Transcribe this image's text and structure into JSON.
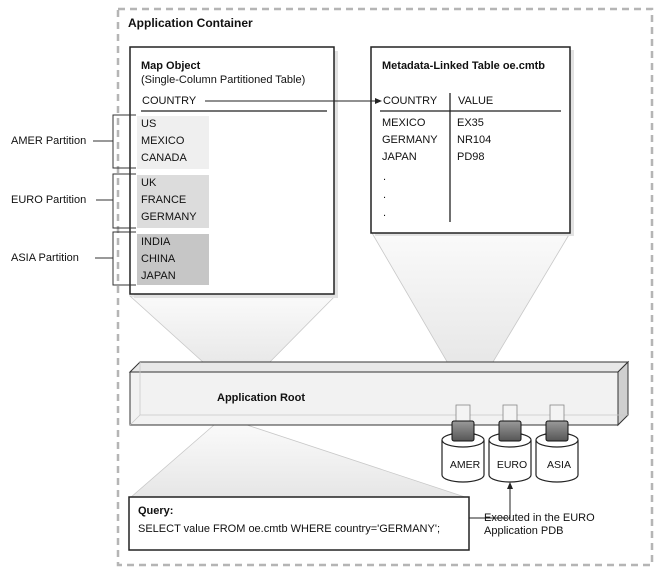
{
  "container": {
    "title": "Application Container"
  },
  "map_object": {
    "title": "Map Object",
    "subtitle": "(Single-Column Partitioned Table)",
    "column": "COUNTRY",
    "partitions": [
      {
        "label": "AMER Partition",
        "rows": [
          "US",
          "MEXICO",
          "CANADA"
        ],
        "color": "#eeeeee"
      },
      {
        "label": "EURO Partition",
        "rows": [
          "UK",
          "FRANCE",
          "GERMANY"
        ],
        "color": "#dcdcdc"
      },
      {
        "label": "ASIA Partition",
        "rows": [
          "INDIA",
          "CHINA",
          "JAPAN"
        ],
        "color": "#c4c4c4"
      }
    ]
  },
  "linked_table": {
    "title": "Metadata-Linked Table oe.cmtb",
    "columns": [
      "COUNTRY",
      "VALUE"
    ],
    "rows": [
      [
        "MEXICO",
        "EX35"
      ],
      [
        "GERMANY",
        "NR104"
      ],
      [
        "JAPAN",
        "PD98"
      ],
      [
        ".",
        ""
      ],
      [
        ".",
        ""
      ],
      [
        ".",
        ""
      ]
    ]
  },
  "app_root": {
    "label": "Application Root"
  },
  "pdbs": [
    "AMER",
    "EURO",
    "ASIA"
  ],
  "query": {
    "label": "Query:",
    "sql": "SELECT value FROM oe.cmtb WHERE country='GERMANY';"
  },
  "execution_note": {
    "line1": "Executed in the EURO",
    "line2": "Application PDB"
  }
}
